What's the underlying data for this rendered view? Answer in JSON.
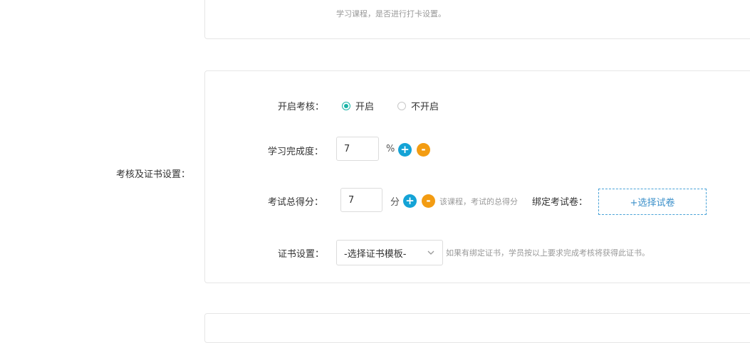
{
  "top_section": {
    "hint": "学习课程，是否进行打卡设置。"
  },
  "exam_section": {
    "section_label": "考核及证书设置：",
    "enable": {
      "label": "开启考核：",
      "options": [
        "开启",
        "不开启"
      ],
      "selected": "开启"
    },
    "completion": {
      "label": "学习完成度：",
      "value": "7",
      "unit": "%"
    },
    "score": {
      "label": "考试总得分：",
      "value": "7",
      "unit": "分",
      "hint": "该课程，考试的总得分",
      "bind_label": "绑定考试卷：",
      "select_paper_button": "+选择试卷"
    },
    "certificate": {
      "label": "证书设置：",
      "select_value": "-选择证书模板-",
      "hint": "如果有绑定证书，学员按以上要求完成考核将获得此证书。"
    }
  },
  "icons": {
    "plus": "plus-icon",
    "minus": "minus-icon",
    "chevron": "chevron-down-icon"
  },
  "colors": {
    "accent_green": "#1ab3a6",
    "plus_blue": "#14a3d6",
    "minus_orange": "#f39c12",
    "dashed_blue": "#4aa3d8"
  }
}
